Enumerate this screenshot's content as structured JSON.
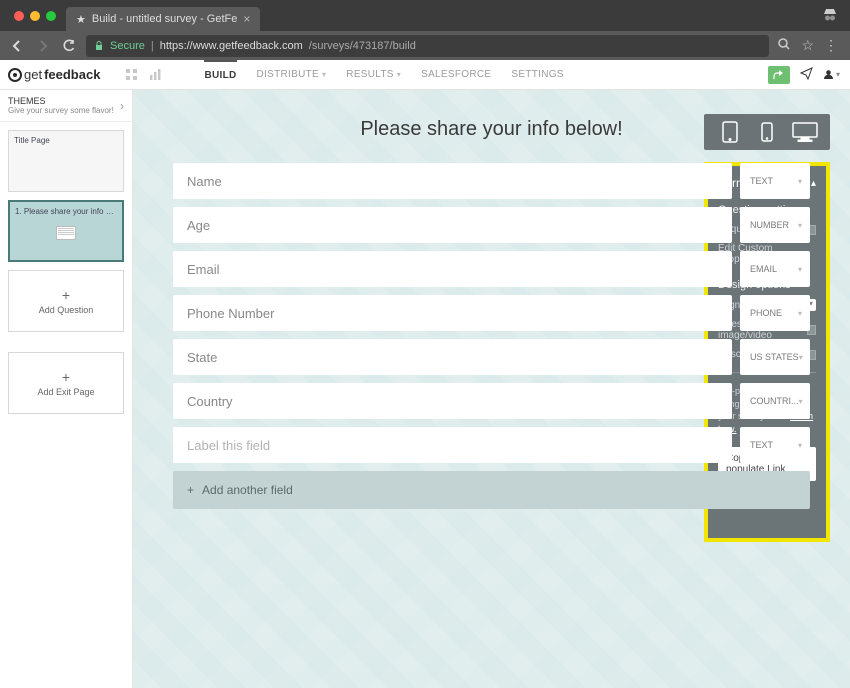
{
  "browser": {
    "tab_title": "Build - untitled survey - GetFe",
    "secure_label": "Secure",
    "url_host": "https://www.getfeedback.com",
    "url_path": "/surveys/473187/build"
  },
  "brand": {
    "prefix": "get",
    "suffix": "feedback"
  },
  "nav": {
    "tabs": [
      {
        "label": "BUILD",
        "active": true
      },
      {
        "label": "DISTRIBUTE",
        "caret": true
      },
      {
        "label": "RESULTS",
        "caret": true
      },
      {
        "label": "SALESFORCE"
      },
      {
        "label": "SETTINGS"
      }
    ]
  },
  "sidebar": {
    "themes_title": "THEMES",
    "themes_sub": "Give your survey some flavor!",
    "thumbs": [
      {
        "label": "Title Page",
        "selected": false
      },
      {
        "label": "1. Please share your info bel...",
        "selected": true,
        "hasMini": true
      }
    ],
    "add_question": "Add Question",
    "add_exit": "Add Exit Page"
  },
  "form": {
    "title": "Please share your info below!",
    "fields": [
      {
        "label": "Name",
        "type": "TEXT"
      },
      {
        "label": "Age",
        "type": "NUMBER"
      },
      {
        "label": "Email",
        "type": "EMAIL"
      },
      {
        "label": "Phone Number",
        "type": "PHONE"
      },
      {
        "label": "State",
        "type": "US STATES"
      },
      {
        "label": "Country",
        "type": "COUNTRI..."
      },
      {
        "label": "Label this field",
        "type": "TEXT"
      }
    ],
    "add_field": "Add another field"
  },
  "panel": {
    "title": "Form",
    "question_settings": "Question settings",
    "required": "Required",
    "edit_dropdowns": "Edit Custom Dropdowns",
    "design_options": "Design options",
    "alignment": "Alignment",
    "alignment_value": "center",
    "image_video": "Question image/video",
    "description": "Description",
    "prepop_text": "Pre-populate forms using merge fields in your survey URL.",
    "learn_how": "Learn how.",
    "copy_btn": "Copy Pre-populate Link"
  }
}
